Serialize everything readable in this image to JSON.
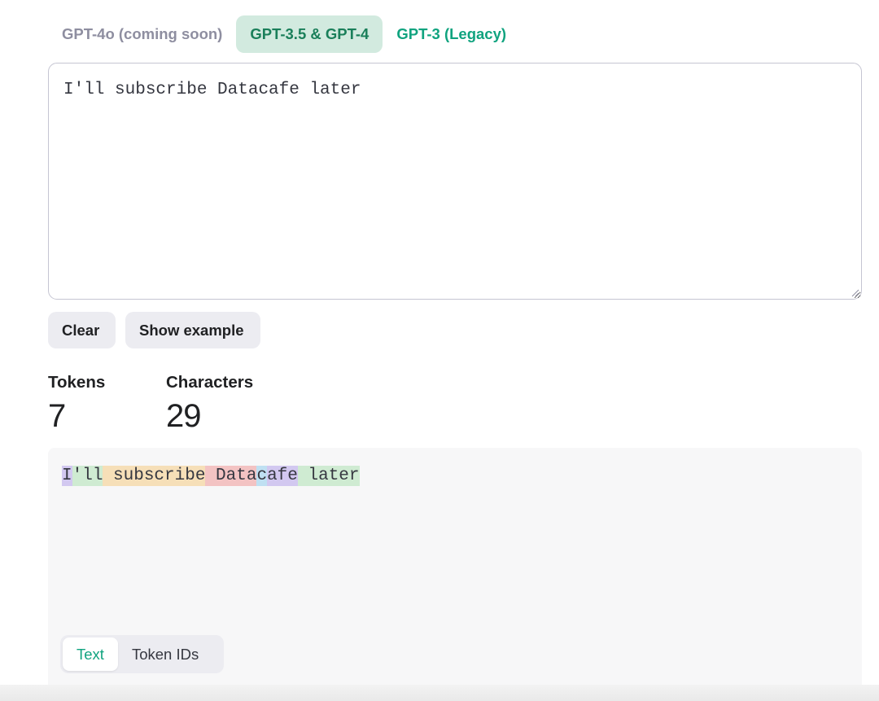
{
  "model_tabs": [
    {
      "label": "GPT-4o (coming soon)",
      "state": "disabled"
    },
    {
      "label": "GPT-3.5 & GPT-4",
      "state": "active"
    },
    {
      "label": "GPT-3 (Legacy)",
      "state": "normal"
    }
  ],
  "input": {
    "value": "I'll subscribe Datacafe later"
  },
  "actions": {
    "clear_label": "Clear",
    "example_label": "Show example"
  },
  "stats": {
    "tokens_label": "Tokens",
    "tokens_value": "7",
    "characters_label": "Characters",
    "characters_value": "29"
  },
  "tokens": [
    {
      "text": "I",
      "color": "#d2c8f0"
    },
    {
      "text": "'ll",
      "color": "#cfebd2"
    },
    {
      "text": " subscribe",
      "color": "#f6dfb8"
    },
    {
      "text": " Data",
      "color": "#f3c3c3"
    },
    {
      "text": "c",
      "color": "#bfe0f2"
    },
    {
      "text": "afe",
      "color": "#d2c8f0"
    },
    {
      "text": " later",
      "color": "#cfebd2"
    }
  ],
  "view_toggle": {
    "text_label": "Text",
    "token_ids_label": "Token IDs",
    "selected": "Text"
  },
  "colors": {
    "accent": "#10a37f",
    "active_tab_bg": "#d2eadf",
    "button_bg": "#ececf1",
    "panel_bg": "#f7f7f8"
  }
}
